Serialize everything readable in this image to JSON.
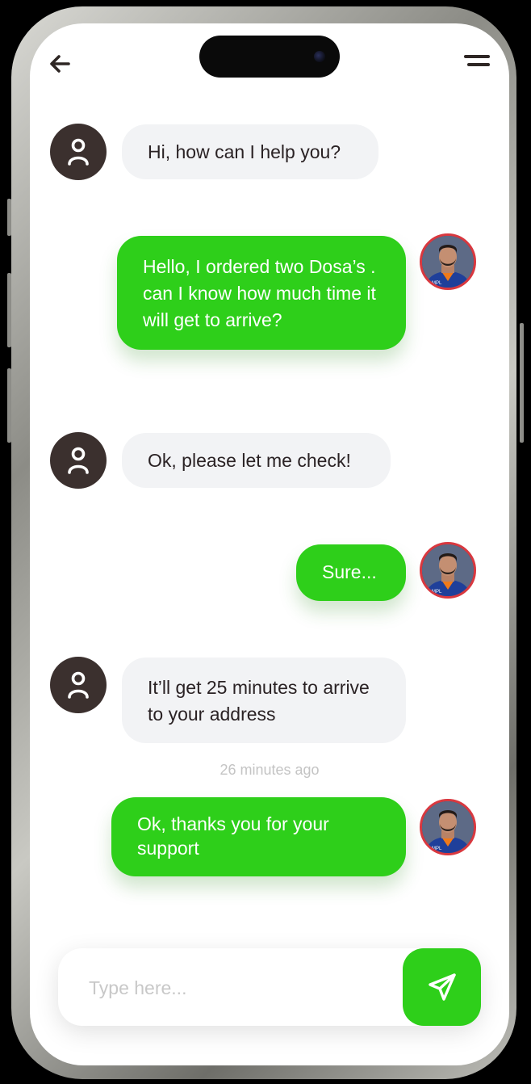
{
  "colors": {
    "accent": "#2ecf1a",
    "incoming_bubble": "#f2f3f5",
    "agent_avatar": "#3b302e",
    "user_avatar_ring": "#d9383f"
  },
  "header": {
    "back_icon": "arrow-left-icon",
    "menu_icon": "menu-icon"
  },
  "messages": [
    {
      "from": "agent",
      "text": "Hi, how can I help you?"
    },
    {
      "from": "user",
      "text": "Hello, I ordered two Dosa’s . can I know how much time it will get to arrive?"
    },
    {
      "from": "agent",
      "text": "Ok, please let me check!"
    },
    {
      "from": "user",
      "text": "Sure..."
    },
    {
      "from": "agent",
      "text": "It’ll get 25 minutes to arrive to your address"
    },
    {
      "from": "user",
      "text": "Ok, thanks you for your support"
    }
  ],
  "timestamp": "26 minutes ago",
  "composer": {
    "placeholder": "Type here...",
    "value": "",
    "send_icon": "send-icon"
  }
}
